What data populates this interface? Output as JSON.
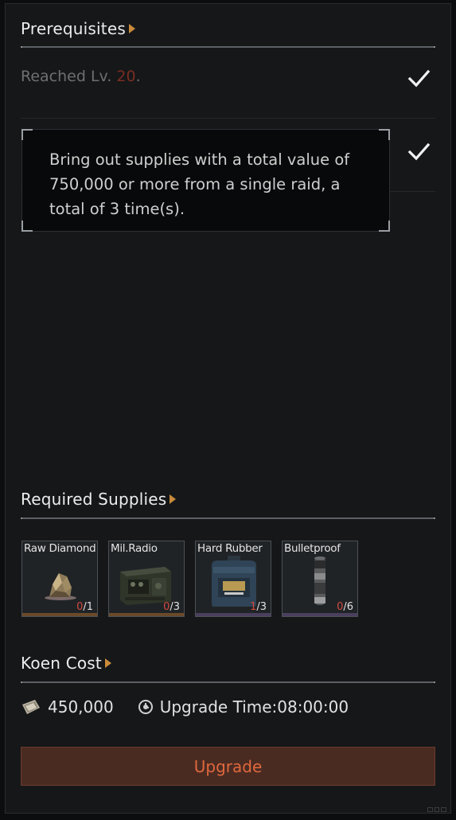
{
  "prerequisites": {
    "title": "Prerequisites",
    "items": [
      {
        "text_prefix": "Reached Lv. ",
        "level": "20",
        "text_suffix": ".",
        "met": true
      },
      {
        "met": true
      }
    ],
    "tooltip": "Bring out supplies with a total value of 750,000 or more from a single raid, a total of 3 time(s)."
  },
  "supplies": {
    "title": "Required Supplies",
    "items": [
      {
        "name": "Raw Diamond",
        "have": "0",
        "need": "/1",
        "icon": "raw-diamond-icon",
        "rarity_color": "#6b4a2a"
      },
      {
        "name": "Mil.Radio",
        "have": "0",
        "need": "/3",
        "icon": "military-radio-icon",
        "rarity_color": "#6b4a2a"
      },
      {
        "name": "Hard Rubber",
        "have": "1",
        "need": "/3",
        "icon": "hard-rubber-canister-icon",
        "rarity_color": "#4a3f5e"
      },
      {
        "name": "Bulletproof",
        "have": "0",
        "need": "/6",
        "icon": "bulletproof-fabric-roll-icon",
        "rarity_color": "#4a3f5e"
      }
    ]
  },
  "koen": {
    "title": "Koen Cost",
    "amount": "450,000",
    "upgrade_time": "Upgrade Time:08:00:00",
    "icons": {
      "currency": "koen-banknote-icon",
      "time": "clock-icon"
    }
  },
  "actions": {
    "upgrade_label": "Upgrade"
  },
  "colors": {
    "accent_arrow": "#c98a3a",
    "upgrade_text": "#e0683d",
    "upgrade_bg": "#4a2b22",
    "level_red": "#7a2d22",
    "count_red": "#d24a3e"
  }
}
